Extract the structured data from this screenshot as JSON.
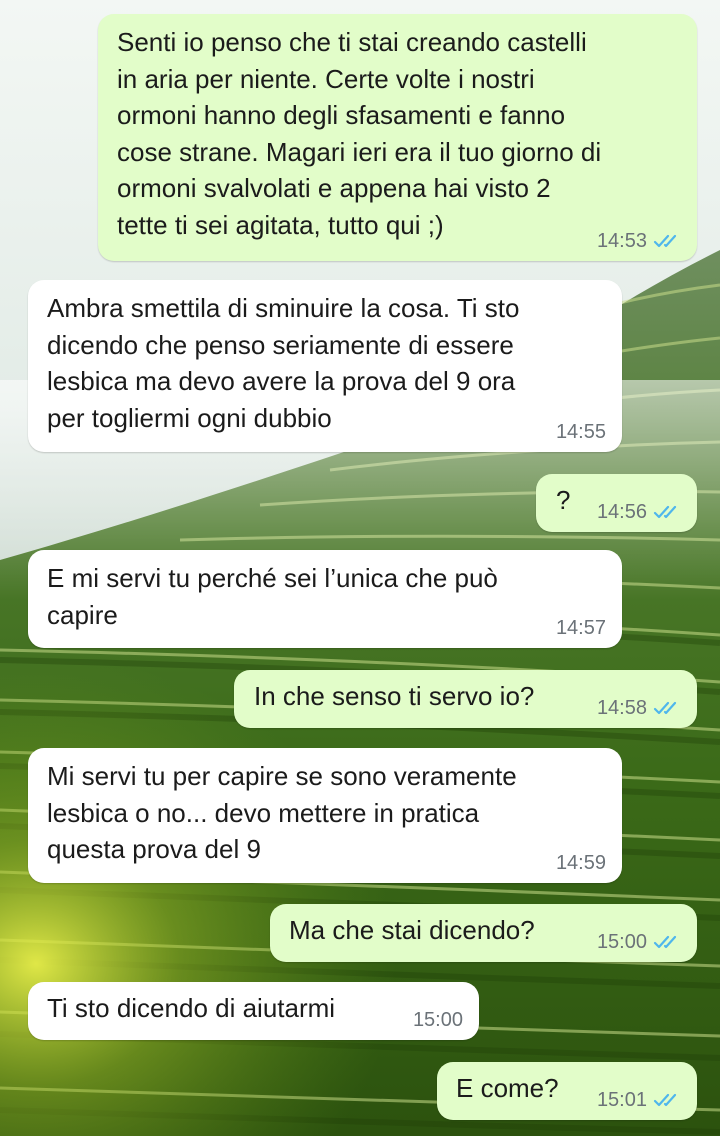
{
  "theme": {
    "outgoing_bubble": "#e2fdc9",
    "incoming_bubble": "#ffffff",
    "read_tick_color": "#4fb6ec",
    "wallpaper": "rice-terraces"
  },
  "messages": [
    {
      "direction": "outgoing",
      "text": "Senti io penso che ti stai creando castelli\nin aria per niente. Certe volte i nostri\normoni hanno degli sfasamenti e fanno\ncose strane. Magari ieri era il tuo giorno di\normoni svalvolati e appena hai visto 2\ntette ti sei agitata, tutto qui ;)",
      "time": "14:53",
      "status": "read"
    },
    {
      "direction": "incoming",
      "text": "Ambra smettila di sminuire la cosa. Ti sto\ndicendo che penso seriamente di essere\nlesbica ma devo avere la prova del 9 ora\nper togliermi ogni dubbio",
      "time": "14:55"
    },
    {
      "direction": "outgoing",
      "text": "?",
      "time": "14:56",
      "status": "read"
    },
    {
      "direction": "incoming",
      "text": "E mi servi tu perché sei l’unica che può\ncapire",
      "time": "14:57"
    },
    {
      "direction": "outgoing",
      "text": "In che senso ti servo io?",
      "time": "14:58",
      "status": "read"
    },
    {
      "direction": "incoming",
      "text": "Mi servi tu per capire se sono veramente\nlesbica o no... devo mettere in pratica\nquesta prova del 9",
      "time": "14:59"
    },
    {
      "direction": "outgoing",
      "text": "Ma che stai dicendo?",
      "time": "15:00",
      "status": "read"
    },
    {
      "direction": "incoming",
      "text": "Ti sto dicendo di aiutarmi",
      "time": "15:00"
    },
    {
      "direction": "outgoing",
      "text": "E come?",
      "time": "15:01",
      "status": "read"
    }
  ]
}
